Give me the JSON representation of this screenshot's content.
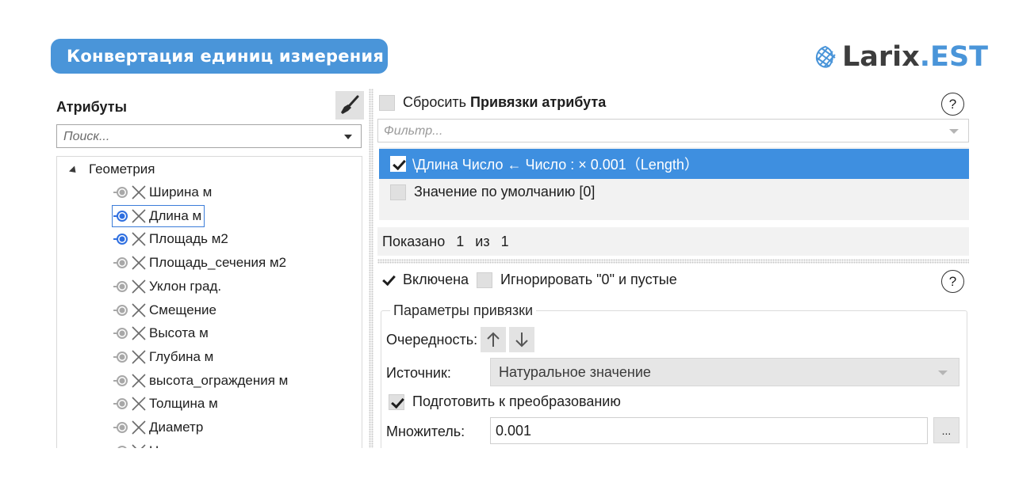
{
  "banner": {
    "title": "Конвертация единиц измерения"
  },
  "logo": {
    "part1": "Larix",
    "part2": ".EST"
  },
  "left_panel": {
    "title": "Атрибуты",
    "search_placeholder": "Поиск...",
    "group": "Геометрия",
    "items": [
      {
        "label": "Ширина м",
        "linked": false,
        "selected": false
      },
      {
        "label": "Длина м",
        "linked": true,
        "selected": true
      },
      {
        "label": "Площадь м2",
        "linked": true,
        "selected": false
      },
      {
        "label": "Площадь_сечения м2",
        "linked": false,
        "selected": false
      },
      {
        "label": "Уклон град.",
        "linked": false,
        "selected": false
      },
      {
        "label": "Смещение",
        "linked": false,
        "selected": false
      },
      {
        "label": "Высота м",
        "linked": false,
        "selected": false
      },
      {
        "label": "Глубина м",
        "linked": false,
        "selected": false
      },
      {
        "label": "высота_ограждения м",
        "linked": false,
        "selected": false
      },
      {
        "label": "Толщина м",
        "linked": false,
        "selected": false
      },
      {
        "label": "Диаметр",
        "linked": false,
        "selected": false
      },
      {
        "label": "Непрямая_высота м",
        "linked": false,
        "selected": false
      }
    ]
  },
  "right_panel": {
    "reset_label": "Сбросить",
    "bindings_title": "Привязки атрибута",
    "help": "?",
    "filter_placeholder": "Фильтр...",
    "list": {
      "row1": "\\Длина Число ← Число : × 0.001（Length）",
      "row2": "Значение по умолчанию [0]"
    },
    "shown": {
      "label": "Показано",
      "count": "1",
      "of": "из",
      "total": "1"
    },
    "enabled_label": "Включена",
    "ignore_label": "Игнорировать \"0\" и пустые",
    "params_title": "Параметры привязки",
    "order_label": "Очередность:",
    "source_label": "Источник:",
    "source_value": "Натуральное значение",
    "prepare_label": "Подготовить к преобразованию",
    "multiplier_label": "Множитель:",
    "multiplier_value": "0.001",
    "ellipsis": "..."
  },
  "colors": {
    "accent": "#4a95d9",
    "selection": "#3e8fe0",
    "link_active": "#2f6fe0",
    "link_inactive": "#a8a8a8"
  }
}
